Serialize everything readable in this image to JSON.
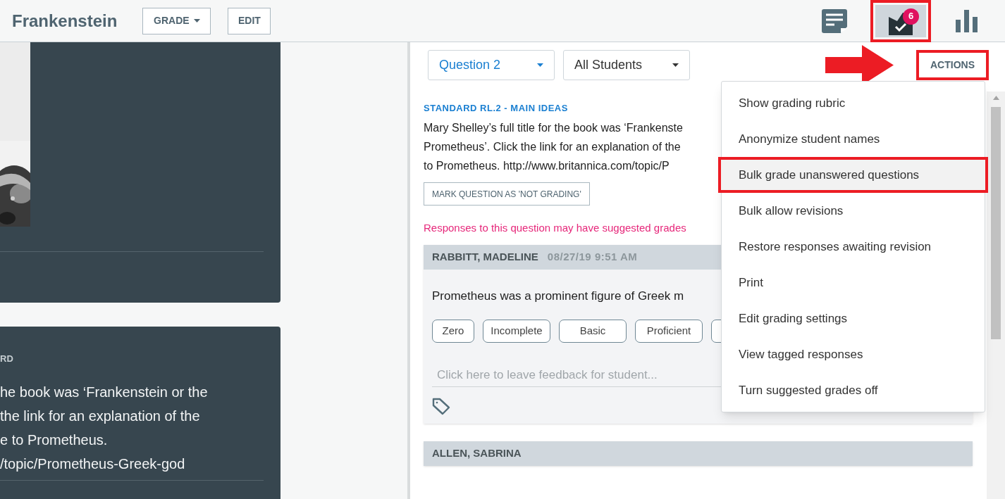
{
  "header": {
    "title": "Frankenstein",
    "buttons": [
      {
        "label": "GRADE",
        "dropdown": true
      },
      {
        "label": "EDIT",
        "dropdown": false
      }
    ],
    "tools": [
      {
        "kind": "notes",
        "selected": false,
        "annotated": false
      },
      {
        "kind": "inbox",
        "selected": true,
        "annotated": true,
        "badge": "6"
      },
      {
        "kind": "chart",
        "selected": false,
        "annotated": false
      }
    ]
  },
  "left_cards": [
    {
      "kind": "picture"
    },
    {
      "kind": "text",
      "label": "RD",
      "lines": [
        "he book was ‘Frankenstein or the",
        "the link for an explanation of the",
        "e to Prometheus.",
        "/topic/Prometheus-Greek-god"
      ]
    }
  ],
  "filters": [
    {
      "label": "Question 2",
      "kind": "question"
    },
    {
      "label": "All Students",
      "kind": "students"
    }
  ],
  "actions": {
    "label": "ACTIONS",
    "annotated": true,
    "arrow": true
  },
  "menu": [
    {
      "label": "Show grading rubric",
      "selected": false,
      "annotated": false
    },
    {
      "label": "Anonymize student names",
      "selected": false,
      "annotated": false
    },
    {
      "label": "Bulk grade unanswered questions",
      "selected": true,
      "annotated": true
    },
    {
      "label": "Bulk allow revisions",
      "selected": false,
      "annotated": false
    },
    {
      "label": "Restore responses awaiting revision",
      "selected": false,
      "annotated": false
    },
    {
      "label": "Print",
      "selected": false,
      "annotated": false
    },
    {
      "label": "Edit grading settings",
      "selected": false,
      "annotated": false
    },
    {
      "label": "View tagged responses",
      "selected": false,
      "annotated": false
    },
    {
      "label": "Turn suggested grades off",
      "selected": false,
      "annotated": false
    }
  ],
  "question": {
    "standard": "STANDARD RL.2 - MAIN IDEAS",
    "lines": [
      "Mary Shelley’s full title for the book was ‘Frankenste",
      "Prometheus’. Click the link for an explanation of the",
      "to Prometheus. http://www.britannica.com/topic/P"
    ],
    "mark_button": "MARK QUESTION AS 'NOT GRADING'",
    "notice": "Responses to this question may have suggested grades"
  },
  "responses": [
    {
      "name": "RABBITT, MADELINE",
      "time": "08/27/19 9:51 AM",
      "answer": "Prometheus was a prominent figure of Greek m",
      "grades": [
        {
          "label": "Zero"
        },
        {
          "label": "Incomplete"
        },
        {
          "label": "Basic"
        },
        {
          "label": "Proficient"
        },
        {
          "covered": true
        }
      ],
      "feedback_placeholder": "Click here to leave feedback for student..."
    },
    {
      "name": "ALLEN, SABRINA"
    }
  ]
}
